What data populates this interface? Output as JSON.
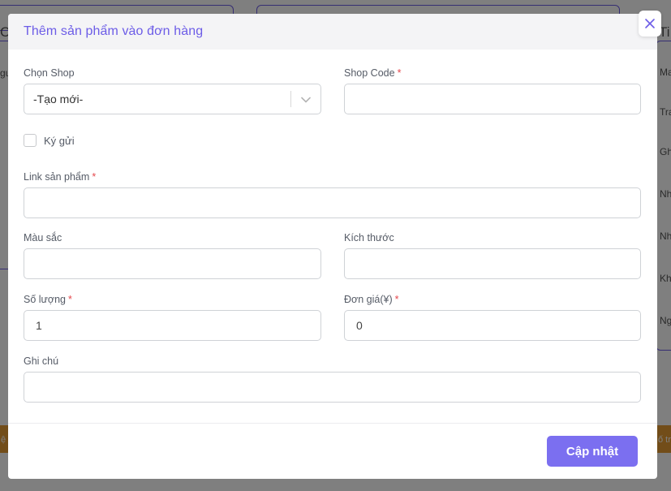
{
  "background": {
    "left_text": [
      "Ch",
      "gu"
    ],
    "right_text": [
      "Ti",
      "Ma",
      "Tra",
      "Gh",
      "Nh",
      "Nh",
      "Kh",
      "Ng"
    ],
    "bar_left_text": "ệ",
    "bar_right_text": "ố tr"
  },
  "modal": {
    "title": "Thêm sản phẩm vào đơn hàng",
    "close_icon": "close-icon",
    "fields": {
      "shop": {
        "label": "Chọn Shop",
        "value": "-Tạo mới-"
      },
      "shop_code": {
        "label": "Shop Code",
        "required": "*",
        "value": ""
      },
      "consign": {
        "label": "Ký gửi",
        "checked": false
      },
      "product_link": {
        "label": "Link sản phẩm",
        "required": "*",
        "value": ""
      },
      "color": {
        "label": "Màu sắc",
        "value": ""
      },
      "size": {
        "label": "Kích thước",
        "value": ""
      },
      "quantity": {
        "label": "Số lượng",
        "required": "*",
        "value": "1"
      },
      "unit_price": {
        "label": "Đơn giá(¥)",
        "required": "*",
        "value": "0"
      },
      "note": {
        "label": "Ghi chú",
        "value": ""
      }
    },
    "submit_label": "Cập nhật"
  },
  "colors": {
    "accent": "#6c5ce7",
    "button": "#7b6ff0",
    "required": "#e5484d",
    "bar": "#e59a33"
  }
}
